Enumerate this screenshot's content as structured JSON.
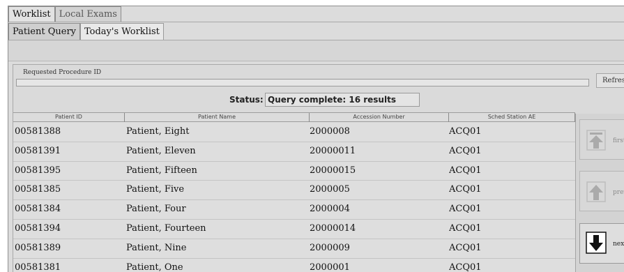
{
  "tabs": {
    "main": [
      {
        "label": "Worklist",
        "active": true
      },
      {
        "label": "Local Exams",
        "active": false
      }
    ],
    "sub": [
      {
        "label": "Patient Query",
        "active": false
      },
      {
        "label": "Today's Worklist",
        "active": true
      }
    ]
  },
  "query": {
    "requested_procedure_label": "Requested Procedure ID",
    "requested_procedure_value": "",
    "refresh_label": "Refresh"
  },
  "status": {
    "label": "Status:",
    "value": "Query complete: 16 results"
  },
  "table": {
    "headers": [
      "Patient ID",
      "Patient Name",
      "Accession Number",
      "Sched Station AE"
    ],
    "rows": [
      [
        "00581388",
        "Patient, Eight",
        "2000008",
        "ACQ01"
      ],
      [
        "00581391",
        "Patient, Eleven",
        "20000011",
        "ACQ01"
      ],
      [
        "00581395",
        "Patient, Fifteen",
        "20000015",
        "ACQ01"
      ],
      [
        "00581385",
        "Patient, Five",
        "2000005",
        "ACQ01"
      ],
      [
        "00581384",
        "Patient, Four",
        "2000004",
        "ACQ01"
      ],
      [
        "00581394",
        "Patient, Fourteen",
        "20000014",
        "ACQ01"
      ],
      [
        "00581389",
        "Patient, Nine",
        "2000009",
        "ACQ01"
      ],
      [
        "00581381",
        "Patient, One",
        "2000001",
        "ACQ01"
      ]
    ]
  },
  "nav": {
    "first_label": "first",
    "prev_label": "prev",
    "next_label": "next",
    "first_icon": "arrow-up-to-top-icon",
    "prev_icon": "arrow-up-icon",
    "next_icon": "arrow-down-icon"
  }
}
